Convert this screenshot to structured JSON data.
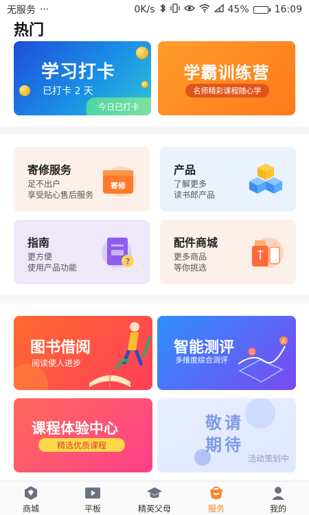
{
  "status_bar": {
    "carrier": "无服务",
    "dots": "···",
    "speed": "0K/s",
    "battery": "45%",
    "battery_level": 0.45,
    "time": "16:09"
  },
  "section": {
    "title": "热门"
  },
  "hot": {
    "checkin": {
      "title": "学习打卡",
      "subtitle": "已打卡 2 天",
      "badge": "今日已打卡"
    },
    "camp": {
      "title": "学霸训练营",
      "subtitle": "名师精彩课程随心学"
    }
  },
  "services": [
    {
      "name": "寄修服务",
      "desc1": "足不出户",
      "desc2": "享受贴心售后服务",
      "icon": "repair-box-icon",
      "icon_label": "寄修"
    },
    {
      "name": "产品",
      "desc1": "了解更多",
      "desc2": "读书郎产品",
      "icon": "product-cubes-icon"
    },
    {
      "name": "指南",
      "desc1": "更方便",
      "desc2": "使用产品功能",
      "icon": "guide-document-icon"
    },
    {
      "name": "配件商城",
      "desc1": "更多商品",
      "desc2": "等你挑选",
      "icon": "usb-accessory-icon"
    }
  ],
  "banners": {
    "library": {
      "title": "图书借阅",
      "subtitle": "阅读使人进步"
    },
    "evaluation": {
      "title": "智能测评",
      "subtitle": "多维度综合测评"
    },
    "course": {
      "title": "课程体验中心",
      "subtitle": "精选优质课程"
    },
    "coming": {
      "title1": "敬请",
      "title2": "期待",
      "subtitle": "活动策划中"
    }
  },
  "tabbar": {
    "items": [
      {
        "label": "商城",
        "icon": "mall-icon"
      },
      {
        "label": "平板",
        "icon": "play-video-icon"
      },
      {
        "label": "精英父母",
        "icon": "graduation-cap-icon"
      },
      {
        "label": "服务",
        "icon": "service-icon",
        "active": true
      },
      {
        "label": "我的",
        "icon": "profile-icon"
      }
    ],
    "active_color": "#f08a2e"
  }
}
